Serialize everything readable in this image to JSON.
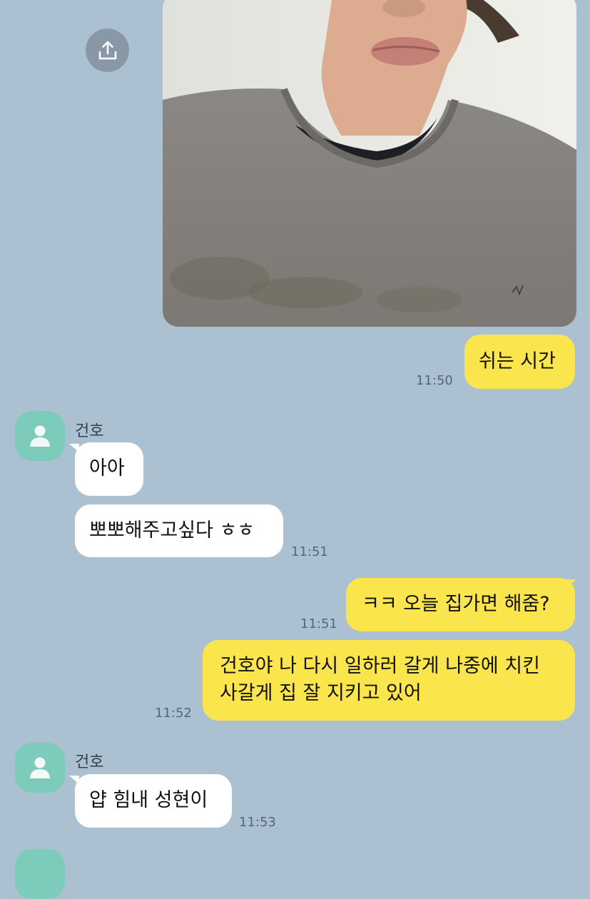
{
  "colors": {
    "background": "#abc1d1",
    "my_bubble": "#fbe54d",
    "their_bubble": "#ffffff",
    "avatar": "#7dcbba"
  },
  "share_icon": "share-upload-icon",
  "messages": {
    "m1": {
      "text": "쉬는 시간",
      "time": "11:50"
    },
    "m2": {
      "sender": "건호",
      "text": "아아"
    },
    "m3": {
      "text": "뽀뽀해주고싶다 ㅎㅎ",
      "time": "11:51"
    },
    "m4": {
      "text": "ㅋㅋ 오늘 집가면 해줌?",
      "time": "11:51"
    },
    "m5": {
      "line1": "건호야 나 다시 일하러 갈게 나중에 치킨",
      "line2": "사갈게 집 잘 지키고 있어",
      "time": "11:52"
    },
    "m6": {
      "sender": "건호",
      "text": "얍 힘내 성현이",
      "time": "11:53"
    }
  }
}
